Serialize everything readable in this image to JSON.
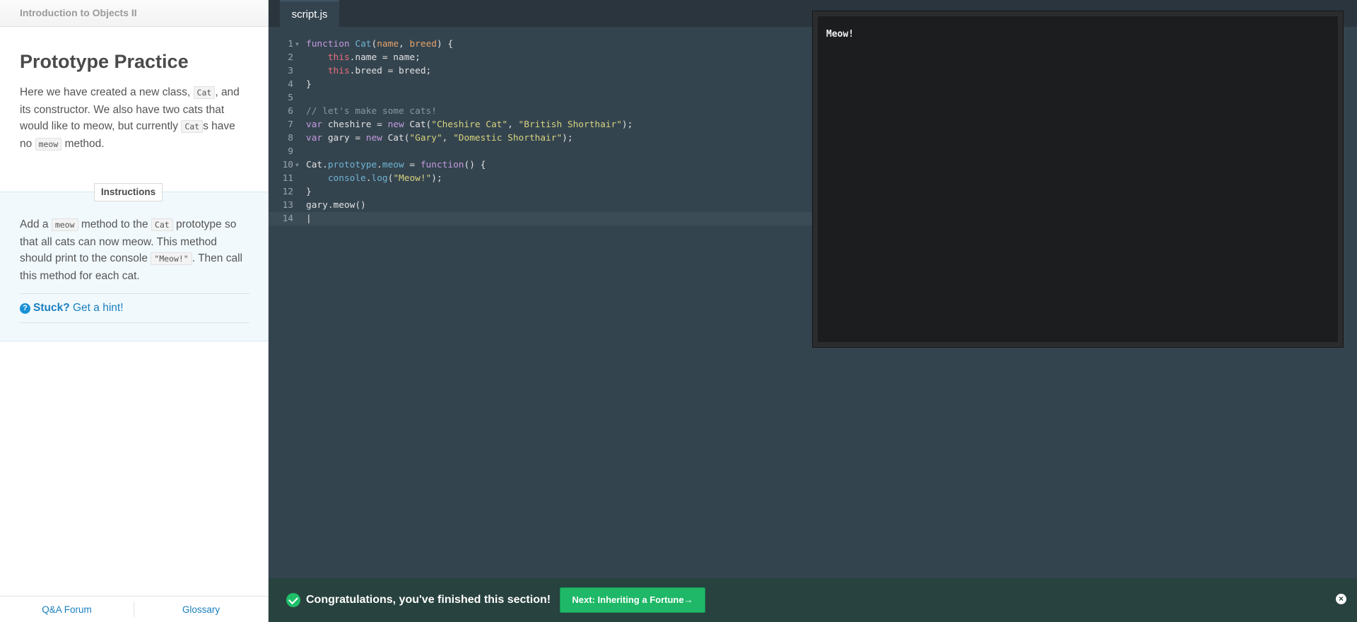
{
  "course": {
    "title": "Introduction to Objects II"
  },
  "lesson": {
    "title": "Prototype Practice",
    "p1": "Here we have created a new class, ",
    "p1_code1": "Cat",
    "p2": ", and its constructor. We also have two cats that would like to meow, but currently ",
    "p2_code": "Cat",
    "p3": "s have no ",
    "p3_code": "meow",
    "p4": " method."
  },
  "instructions": {
    "tab_label": "Instructions",
    "t1": "Add a ",
    "t1_code": "meow",
    "t2": " method to the ",
    "t2_code": "Cat",
    "t3": " prototype so that all cats can now meow. This method should print to the console ",
    "t3_code": "\"Meow!\"",
    "t4": ". Then call this method for each cat.",
    "hint_strong": "Stuck?",
    "hint_link": "Get a hint!"
  },
  "footer": {
    "forum": "Q&A Forum",
    "glossary": "Glossary"
  },
  "editor": {
    "tab": "script.js",
    "lines": [
      "1",
      "2",
      "3",
      "4",
      "5",
      "6",
      "7",
      "8",
      "9",
      "10",
      "11",
      "12",
      "13",
      "14"
    ]
  },
  "console": {
    "output": "Meow!"
  },
  "success": {
    "message": "Congratulations, you've finished this section!",
    "next_button": "Next: Inheriting a Fortune→"
  },
  "colors": {
    "accent": "#1a7fbd",
    "success": "#1fb868",
    "editor_bg": "#34444f"
  }
}
